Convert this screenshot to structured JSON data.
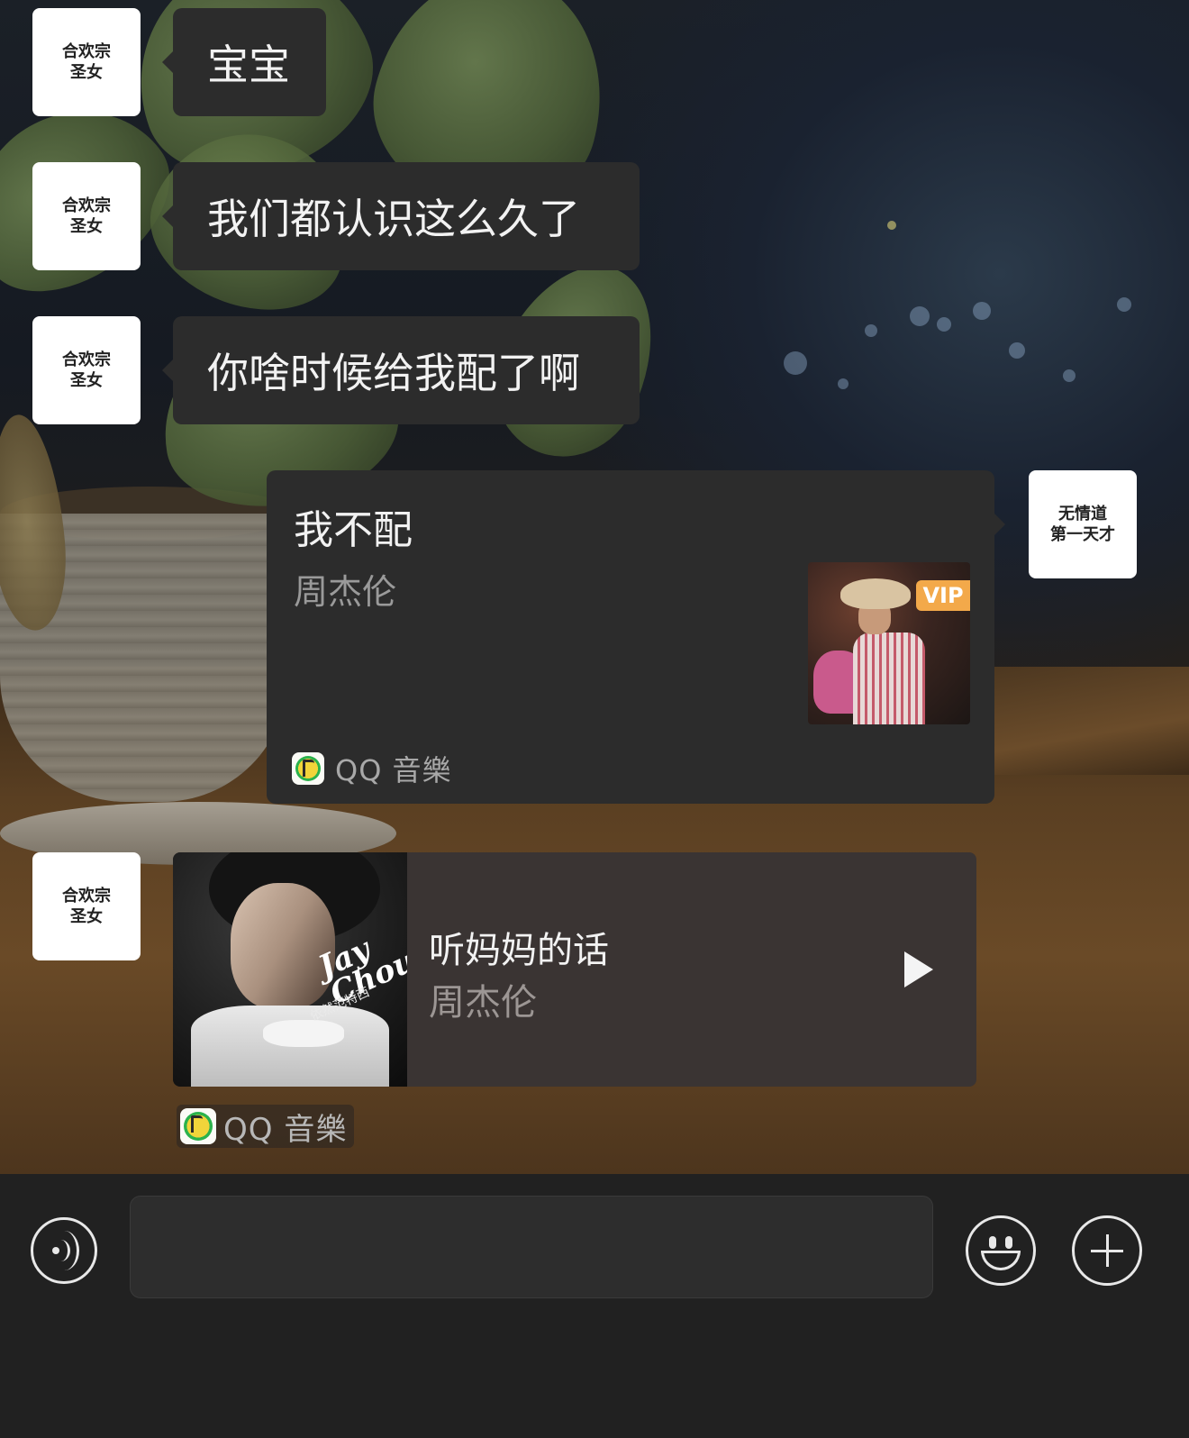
{
  "messages": [
    {
      "sender": "合欢宗圣女",
      "avatar_lines": [
        "合欢宗",
        "圣女"
      ],
      "text": "宝宝"
    },
    {
      "sender": "合欢宗圣女",
      "avatar_lines": [
        "合欢宗",
        "圣女"
      ],
      "text": "我们都认识这么久了"
    },
    {
      "sender": "合欢宗圣女",
      "avatar_lines": [
        "合欢宗",
        "圣女"
      ],
      "text": "你啥时候给我配了啊"
    }
  ],
  "my_avatar_lines": [
    "无情道",
    "第一天才"
  ],
  "music_card_sent": {
    "title": "我不配",
    "artist": "周杰伦",
    "badge": "VIP",
    "source": "QQ 音樂",
    "source_icon": "qq-music-icon"
  },
  "music_card_received": {
    "avatar_lines": [
      "合欢宗",
      "圣女"
    ],
    "title": "听妈妈的话",
    "artist": "周杰伦",
    "cover_text": "Jay Chou",
    "cover_subtext": "依然范特西",
    "play_icon": "play-icon",
    "source": "QQ 音樂",
    "source_icon": "qq-music-icon"
  },
  "input_bar": {
    "voice_icon": "voice-icon",
    "input_value": "",
    "emoji_icon": "emoji-icon",
    "plus_icon": "plus-icon"
  },
  "colors": {
    "bubble": "#2c2c2c",
    "music_card_received": "#3a3433",
    "input_bar": "#212121",
    "vip_badge": "#f3a94a"
  }
}
